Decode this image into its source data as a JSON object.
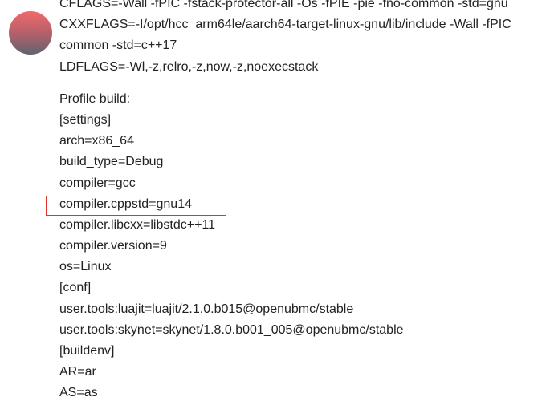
{
  "post": {
    "block1": [
      "CFLAGS=-Wall -fPIC -fstack-protector-all -Os -fPIE -pie -fno-common -std=gnu",
      "CXXFLAGS=-I/opt/hcc_arm64le/aarch64-target-linux-gnu/lib/include -Wall -fPIC",
      "common -std=c++17",
      "LDFLAGS=-Wl,-z,relro,-z,now,-z,noexecstack"
    ],
    "block2": [
      "Profile build:",
      "[settings]",
      "arch=x86_64",
      "build_type=Debug",
      "compiler=gcc",
      "compiler.cppstd=gnu14",
      "compiler.libcxx=libstdc++11",
      "compiler.version=9",
      "os=Linux",
      "[conf]",
      "user.tools:luajit=luajit/2.1.0.b015@openubmc/stable",
      "user.tools:skynet=skynet/1.8.0.b001_005@openubmc/stable",
      "[buildenv]",
      "AR=ar",
      "AS=as"
    ]
  },
  "highlight_color": "#e3312d",
  "icons": {
    "avatar": "user-avatar"
  }
}
